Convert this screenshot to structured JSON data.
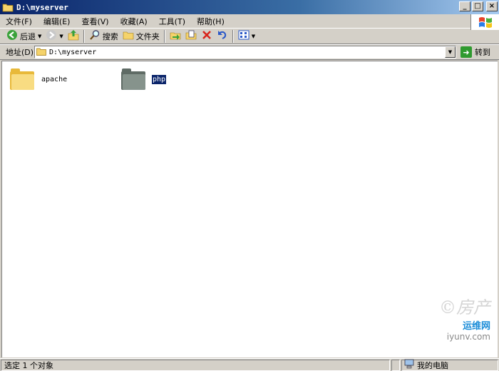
{
  "window": {
    "title": "D:\\myserver",
    "minimize_glyph": "_",
    "maximize_glyph": "□",
    "close_glyph": "×"
  },
  "menu": [
    {
      "label": "文件(F)",
      "icon": null
    },
    {
      "label": "编辑(E)",
      "icon": null
    },
    {
      "label": "查看(V)",
      "icon": null
    },
    {
      "label": "收藏(A)",
      "icon": null
    },
    {
      "label": "工具(T)",
      "icon": null
    },
    {
      "label": "帮助(H)",
      "icon": null
    }
  ],
  "toolbar": {
    "back_label": "后退",
    "search_label": "搜索",
    "folders_label": "文件夹",
    "icons": [
      "back-icon",
      "forward-icon",
      "up-folder-icon",
      "search-icon",
      "folders-icon",
      "move-to-icon",
      "copy-to-icon",
      "delete-icon",
      "undo-icon",
      "views-icon"
    ]
  },
  "address": {
    "label": "地址(D)",
    "value": "D:\\myserver",
    "go_label": "转到"
  },
  "files": [
    {
      "name": "apache",
      "selected": false,
      "color": "#f5d36b"
    },
    {
      "name": "php",
      "selected": true,
      "color": "#7d8a83"
    }
  ],
  "watermark": {
    "line1": "©房产",
    "line2": "iyunv.com",
    "line3": "运维网"
  },
  "status": {
    "selection_text": "选定 1 个对象",
    "location_text": "我的电脑"
  },
  "colors": {
    "title_bar_start": "#0a246a",
    "selection_bg": "#0a246a",
    "window_bg": "#d4d0c8"
  }
}
